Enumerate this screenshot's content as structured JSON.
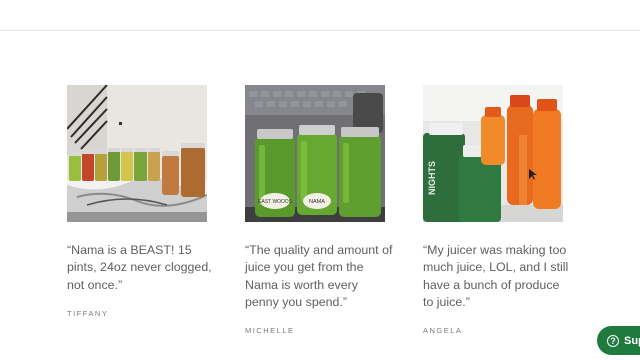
{
  "testimonials": [
    {
      "quote": "“Nama is a BEAST! 15 pints, 24oz never clogged, not once.”",
      "author": "TIFFANY",
      "image": "jars-on-marble-counter"
    },
    {
      "quote": "“The quality and amount of juice you get from the Nama is worth every penny you spend.”",
      "author": "MICHELLE",
      "image": "green-juice-jars",
      "jar_labels": [
        "EAST WOODS",
        "NAMA"
      ]
    },
    {
      "quote": "“My juicer was making too much juice, LOL, and I still have a bunch of produce to juice.”",
      "author": "ANGELA",
      "image": "fridge-juice-bottles",
      "bottle_label": "NIGHTS"
    }
  ],
  "support_button": {
    "icon": "help-circle-icon",
    "icon_glyph": "?",
    "label": "Sup"
  }
}
